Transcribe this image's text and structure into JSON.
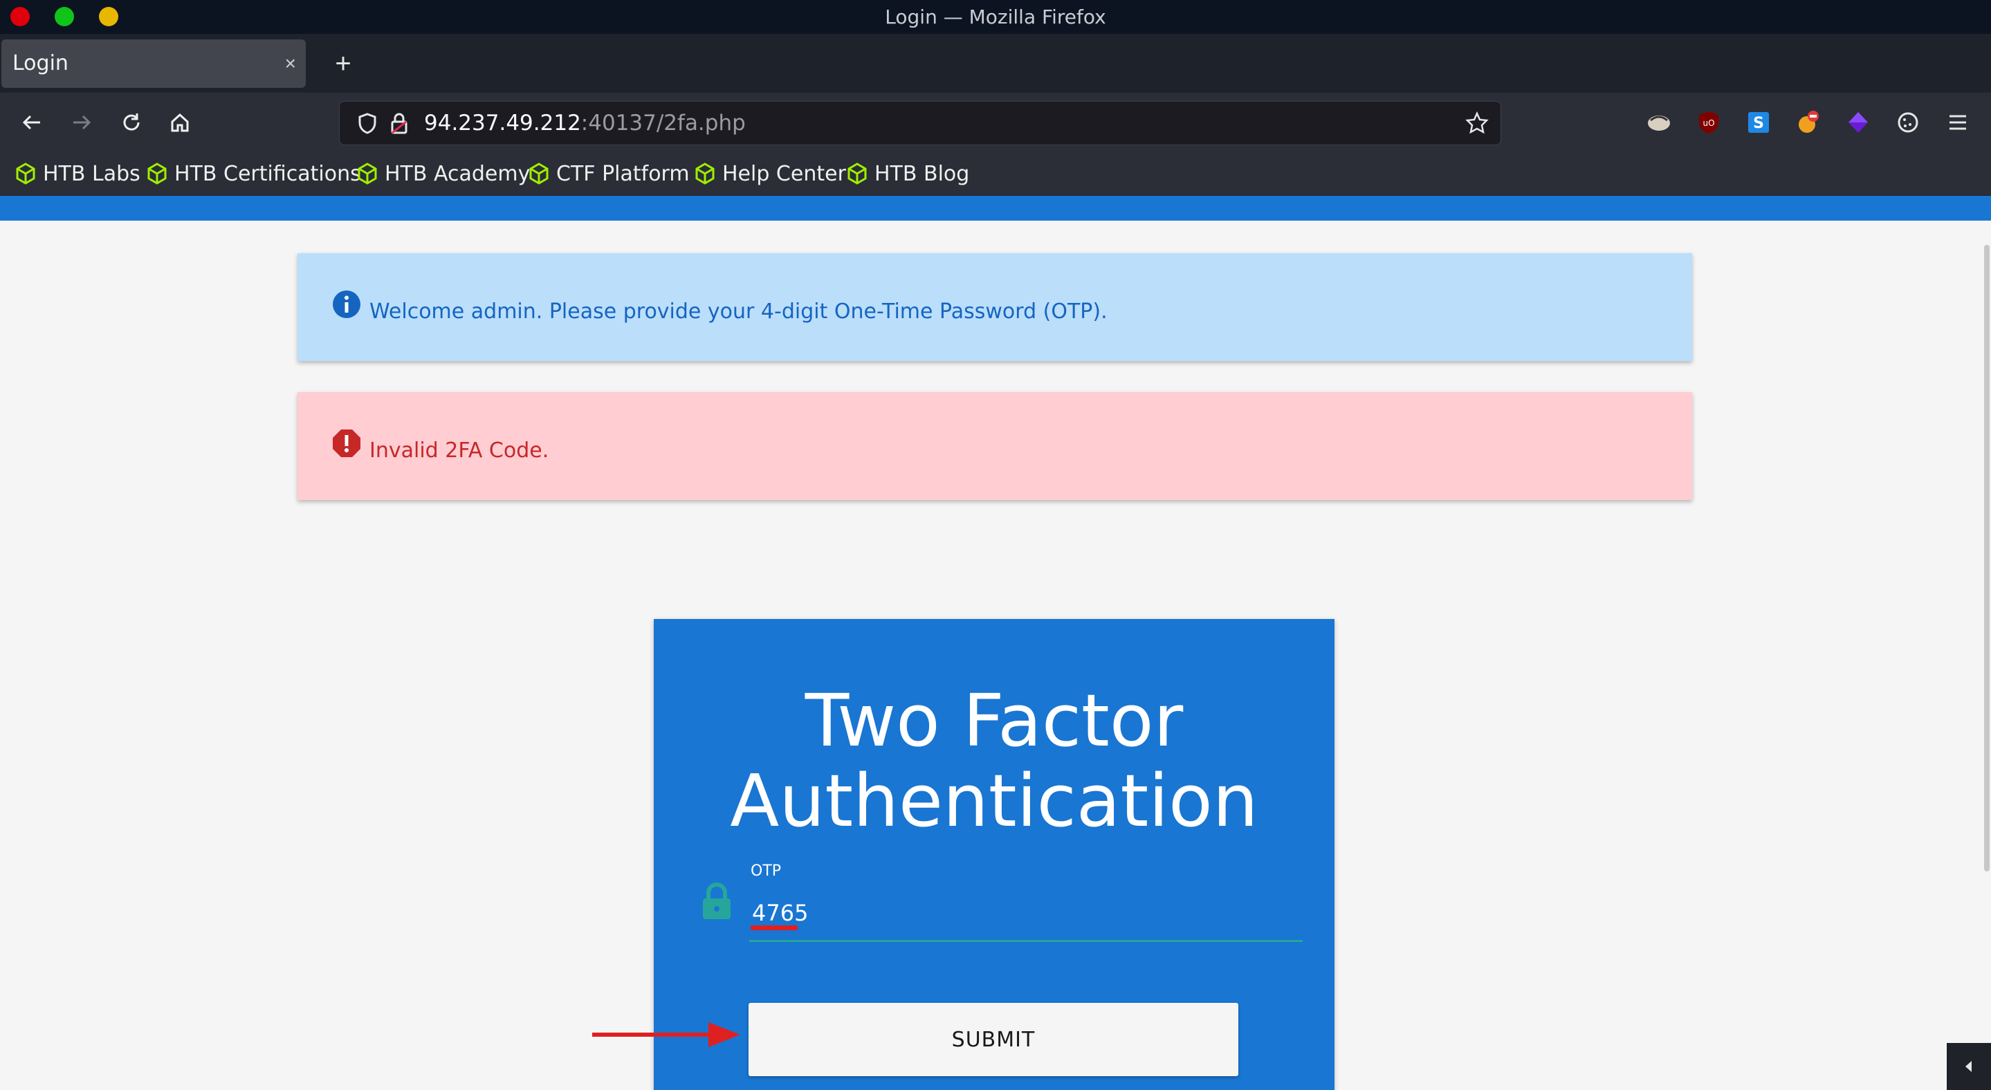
{
  "window": {
    "title": "Login — Mozilla Firefox",
    "traffic_lights": [
      "#e0000b",
      "#10c41a",
      "#e8b800"
    ]
  },
  "tab": {
    "title": "Login",
    "close": "×",
    "new_tab": "+"
  },
  "urlbar": {
    "host": "94.237.49.212",
    "rest": ":40137/2fa.php"
  },
  "bookmarks": [
    "HTB Labs",
    "HTB Certifications",
    "HTB Academy",
    "CTF Platform",
    "Help Center",
    "HTB Blog"
  ],
  "alerts": {
    "info": "Welcome admin. Please provide your 4-digit One-Time Password (OTP).",
    "error": "Invalid 2FA Code."
  },
  "card": {
    "title_line1": "Two Factor",
    "title_line2": "Authentication",
    "otp_label": "OTP",
    "otp_value": "4765",
    "submit_label": "SUBMIT"
  },
  "colors": {
    "accent": "#1976d2",
    "info_bg": "#bbdefb",
    "error_bg": "#ffcdd2",
    "input_underline": "#26a69a",
    "annotation": "#e02020"
  },
  "icons": [
    "back-icon",
    "forward-icon",
    "reload-icon",
    "home-icon",
    "shield-icon",
    "lock-insecure-icon",
    "star-icon",
    "extension-icons",
    "menu-icon",
    "info-icon",
    "error-icon",
    "lock-icon",
    "arrow-annotation"
  ]
}
